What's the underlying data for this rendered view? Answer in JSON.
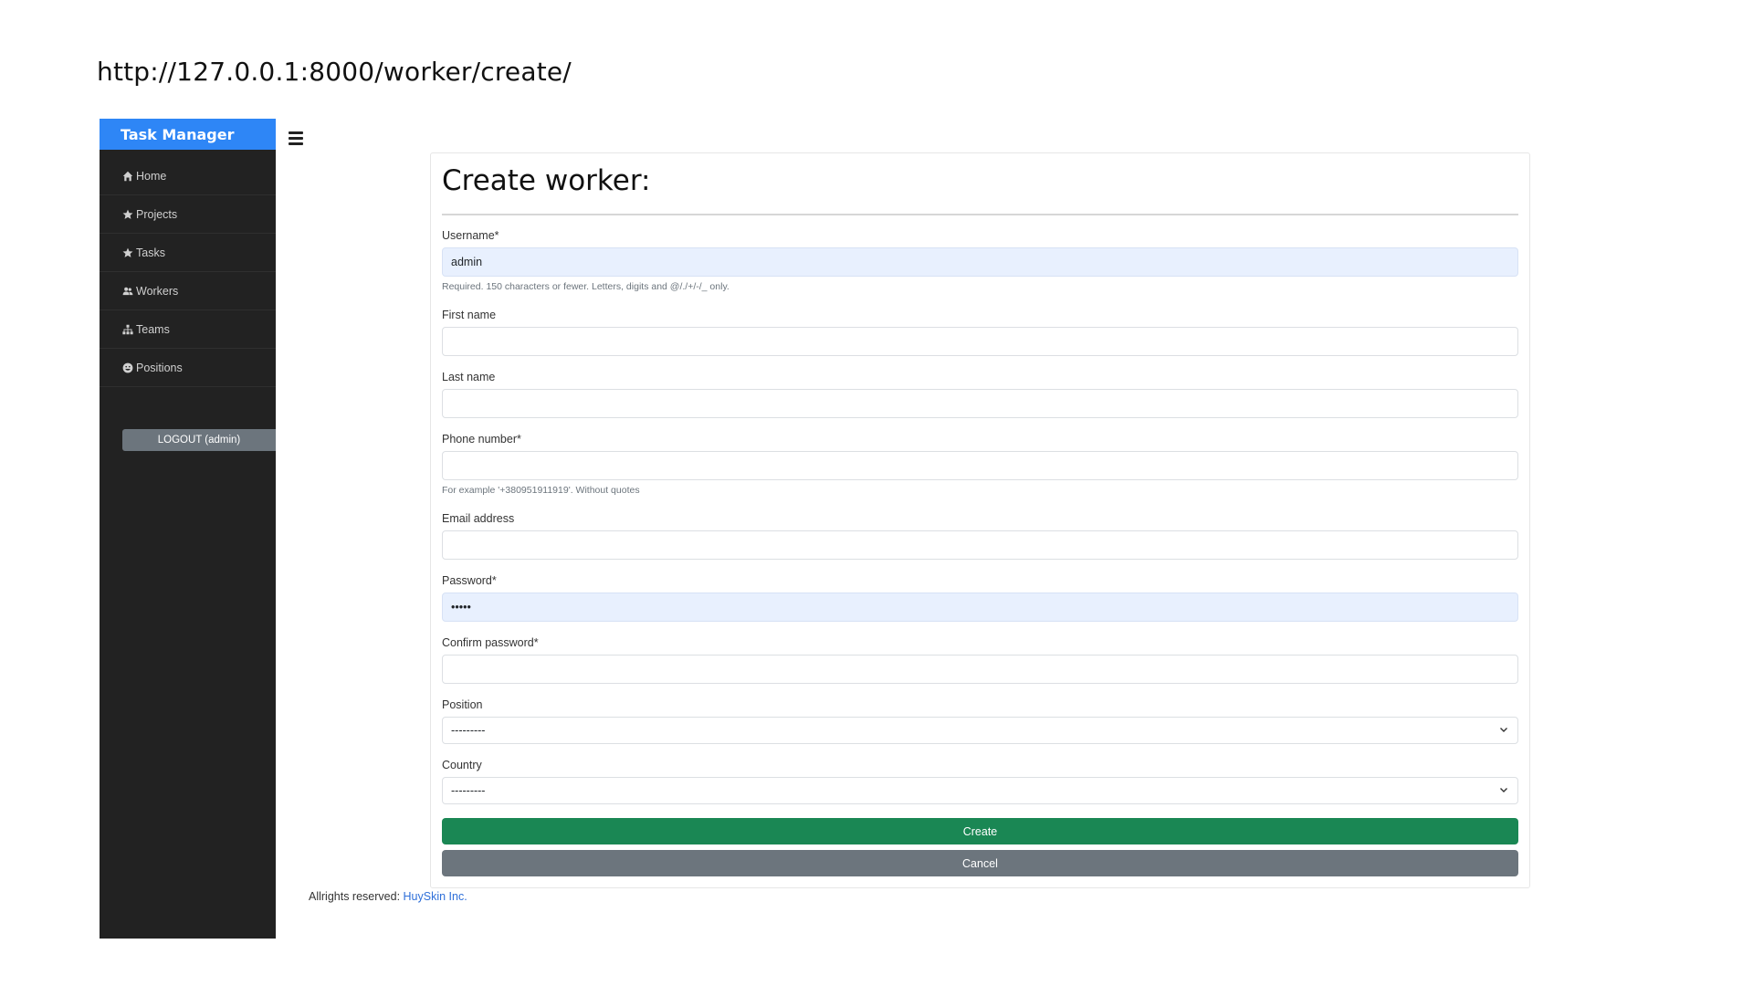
{
  "url": "http://127.0.0.1:8000/worker/create/",
  "sidebar": {
    "brand": "Task Manager",
    "items": [
      {
        "label": "Home",
        "icon": "home-icon"
      },
      {
        "label": "Projects",
        "icon": "star-icon"
      },
      {
        "label": "Tasks",
        "icon": "star-icon"
      },
      {
        "label": "Workers",
        "icon": "users-icon"
      },
      {
        "label": "Teams",
        "icon": "sitemap-icon"
      },
      {
        "label": "Positions",
        "icon": "smile-icon"
      }
    ],
    "logout_label": "LOGOUT (admin)"
  },
  "form": {
    "title": "Create worker:",
    "username": {
      "label": "Username*",
      "value": "admin",
      "help": "Required. 150 characters or fewer. Letters, digits and @/./+/-/_ only."
    },
    "first_name": {
      "label": "First name",
      "value": ""
    },
    "last_name": {
      "label": "Last name",
      "value": ""
    },
    "phone": {
      "label": "Phone number*",
      "value": "",
      "help": "For example '+380951911919'. Without quotes"
    },
    "email": {
      "label": "Email address",
      "value": ""
    },
    "password": {
      "label": "Password*",
      "value": "•••••"
    },
    "confirm_password": {
      "label": "Confirm password*",
      "value": ""
    },
    "position": {
      "label": "Position",
      "selected": "---------"
    },
    "country": {
      "label": "Country",
      "selected": "---------"
    },
    "create_label": "Create",
    "cancel_label": "Cancel"
  },
  "footer": {
    "text": "Allrights reserved:",
    "link": "HuySkin Inc."
  },
  "colors": {
    "brand": "#2e86f6",
    "sidebar": "#222222",
    "create": "#1a8754",
    "cancel": "#6c757d",
    "autofill": "#e8f0fe"
  }
}
